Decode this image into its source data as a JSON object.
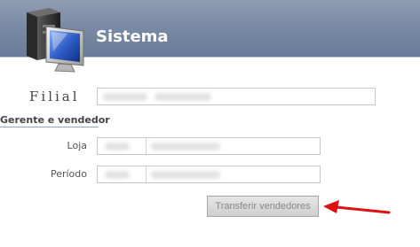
{
  "header": {
    "title": "Sistema",
    "icon": "computer-monitor-icon"
  },
  "form": {
    "filial_label": "Filial",
    "section_title": "Gerente e vendedor",
    "loja_label": "Loja",
    "periodo_label": "Período",
    "transfer_button_label": "Transferir vendedores"
  },
  "colors": {
    "header": "#7889a4",
    "annotation_arrow": "#dd1111"
  }
}
